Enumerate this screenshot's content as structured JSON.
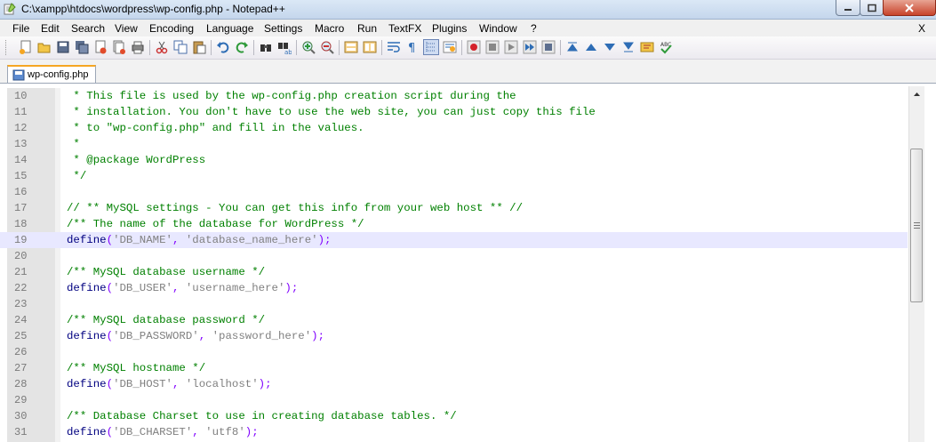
{
  "window": {
    "title": "C:\\xampp\\htdocs\\wordpress\\wp-config.php - Notepad++"
  },
  "menu": {
    "items": [
      "File",
      "Edit",
      "Search",
      "View",
      "Encoding",
      "Language",
      "Settings",
      "Macro",
      "Run",
      "TextFX",
      "Plugins",
      "Window",
      "?"
    ],
    "close": "X"
  },
  "toolbar": {
    "icons": [
      "new-file-icon",
      "open-file-icon",
      "save-icon",
      "save-all-icon",
      "close-icon",
      "close-all-icon",
      "print-icon",
      "cut-icon",
      "copy-icon",
      "paste-icon",
      "undo-icon",
      "redo-icon",
      "find-icon",
      "replace-icon",
      "zoom-in-icon",
      "zoom-out-icon",
      "sync-vertical-icon",
      "sync-horizontal-icon",
      "word-wrap-icon",
      "show-all-chars-icon",
      "indent-guide-icon",
      "user-lang-icon",
      "record-macro-icon",
      "stop-record-icon",
      "play-macro-icon",
      "play-multiple-icon",
      "save-macro-icon",
      "fold-all-icon",
      "collapse-icon",
      "expand-icon",
      "unfold-all-icon",
      "spell-check-icon",
      "spell-check-abc-icon"
    ]
  },
  "tabs": [
    {
      "label": "wp-config.php",
      "active": true
    }
  ],
  "editor": {
    "current_line": "19",
    "lines": [
      {
        "n": "10",
        "parts": [
          {
            "c": "cmt",
            "t": " * This file is used by the wp-config.php creation script during the"
          }
        ]
      },
      {
        "n": "11",
        "parts": [
          {
            "c": "cmt",
            "t": " * installation. You don't have to use the web site, you can just copy this file"
          }
        ]
      },
      {
        "n": "12",
        "parts": [
          {
            "c": "cmt",
            "t": " * to \"wp-config.php\" and fill in the values."
          }
        ]
      },
      {
        "n": "13",
        "parts": [
          {
            "c": "cmt",
            "t": " *"
          }
        ]
      },
      {
        "n": "14",
        "parts": [
          {
            "c": "cmt",
            "t": " * @package WordPress"
          }
        ]
      },
      {
        "n": "15",
        "parts": [
          {
            "c": "cmt",
            "t": " */"
          }
        ]
      },
      {
        "n": "16",
        "parts": []
      },
      {
        "n": "17",
        "parts": [
          {
            "c": "cmt",
            "t": "// ** MySQL settings - You can get this info from your web host ** //"
          }
        ]
      },
      {
        "n": "18",
        "parts": [
          {
            "c": "cmt",
            "t": "/** The name of the database for WordPress */"
          }
        ]
      },
      {
        "n": "19",
        "parts": [
          {
            "c": "kw",
            "t": "define"
          },
          {
            "c": "op",
            "t": "("
          },
          {
            "c": "str",
            "t": "'DB_NAME'"
          },
          {
            "c": "op",
            "t": ", "
          },
          {
            "c": "str",
            "t": "'database_name_here'"
          },
          {
            "c": "op",
            "t": ");"
          }
        ]
      },
      {
        "n": "20",
        "parts": []
      },
      {
        "n": "21",
        "parts": [
          {
            "c": "cmt",
            "t": "/** MySQL database username */"
          }
        ]
      },
      {
        "n": "22",
        "parts": [
          {
            "c": "kw",
            "t": "define"
          },
          {
            "c": "op",
            "t": "("
          },
          {
            "c": "str",
            "t": "'DB_USER'"
          },
          {
            "c": "op",
            "t": ", "
          },
          {
            "c": "str",
            "t": "'username_here'"
          },
          {
            "c": "op",
            "t": ");"
          }
        ]
      },
      {
        "n": "23",
        "parts": []
      },
      {
        "n": "24",
        "parts": [
          {
            "c": "cmt",
            "t": "/** MySQL database password */"
          }
        ]
      },
      {
        "n": "25",
        "parts": [
          {
            "c": "kw",
            "t": "define"
          },
          {
            "c": "op",
            "t": "("
          },
          {
            "c": "str",
            "t": "'DB_PASSWORD'"
          },
          {
            "c": "op",
            "t": ", "
          },
          {
            "c": "str",
            "t": "'password_here'"
          },
          {
            "c": "op",
            "t": ");"
          }
        ]
      },
      {
        "n": "26",
        "parts": []
      },
      {
        "n": "27",
        "parts": [
          {
            "c": "cmt",
            "t": "/** MySQL hostname */"
          }
        ]
      },
      {
        "n": "28",
        "parts": [
          {
            "c": "kw",
            "t": "define"
          },
          {
            "c": "op",
            "t": "("
          },
          {
            "c": "str",
            "t": "'DB_HOST'"
          },
          {
            "c": "op",
            "t": ", "
          },
          {
            "c": "str",
            "t": "'localhost'"
          },
          {
            "c": "op",
            "t": ");"
          }
        ]
      },
      {
        "n": "29",
        "parts": []
      },
      {
        "n": "30",
        "parts": [
          {
            "c": "cmt",
            "t": "/** Database Charset to use in creating database tables. */"
          }
        ]
      },
      {
        "n": "31",
        "parts": [
          {
            "c": "kw",
            "t": "define"
          },
          {
            "c": "op",
            "t": "("
          },
          {
            "c": "str",
            "t": "'DB_CHARSET'"
          },
          {
            "c": "op",
            "t": ", "
          },
          {
            "c": "str",
            "t": "'utf8'"
          },
          {
            "c": "op",
            "t": ");"
          }
        ]
      }
    ]
  },
  "colors": {
    "comment": "#008000",
    "keyword": "#000080",
    "string": "#808080",
    "operator": "#8000ff",
    "current_line_bg": "#e8e8ff"
  }
}
